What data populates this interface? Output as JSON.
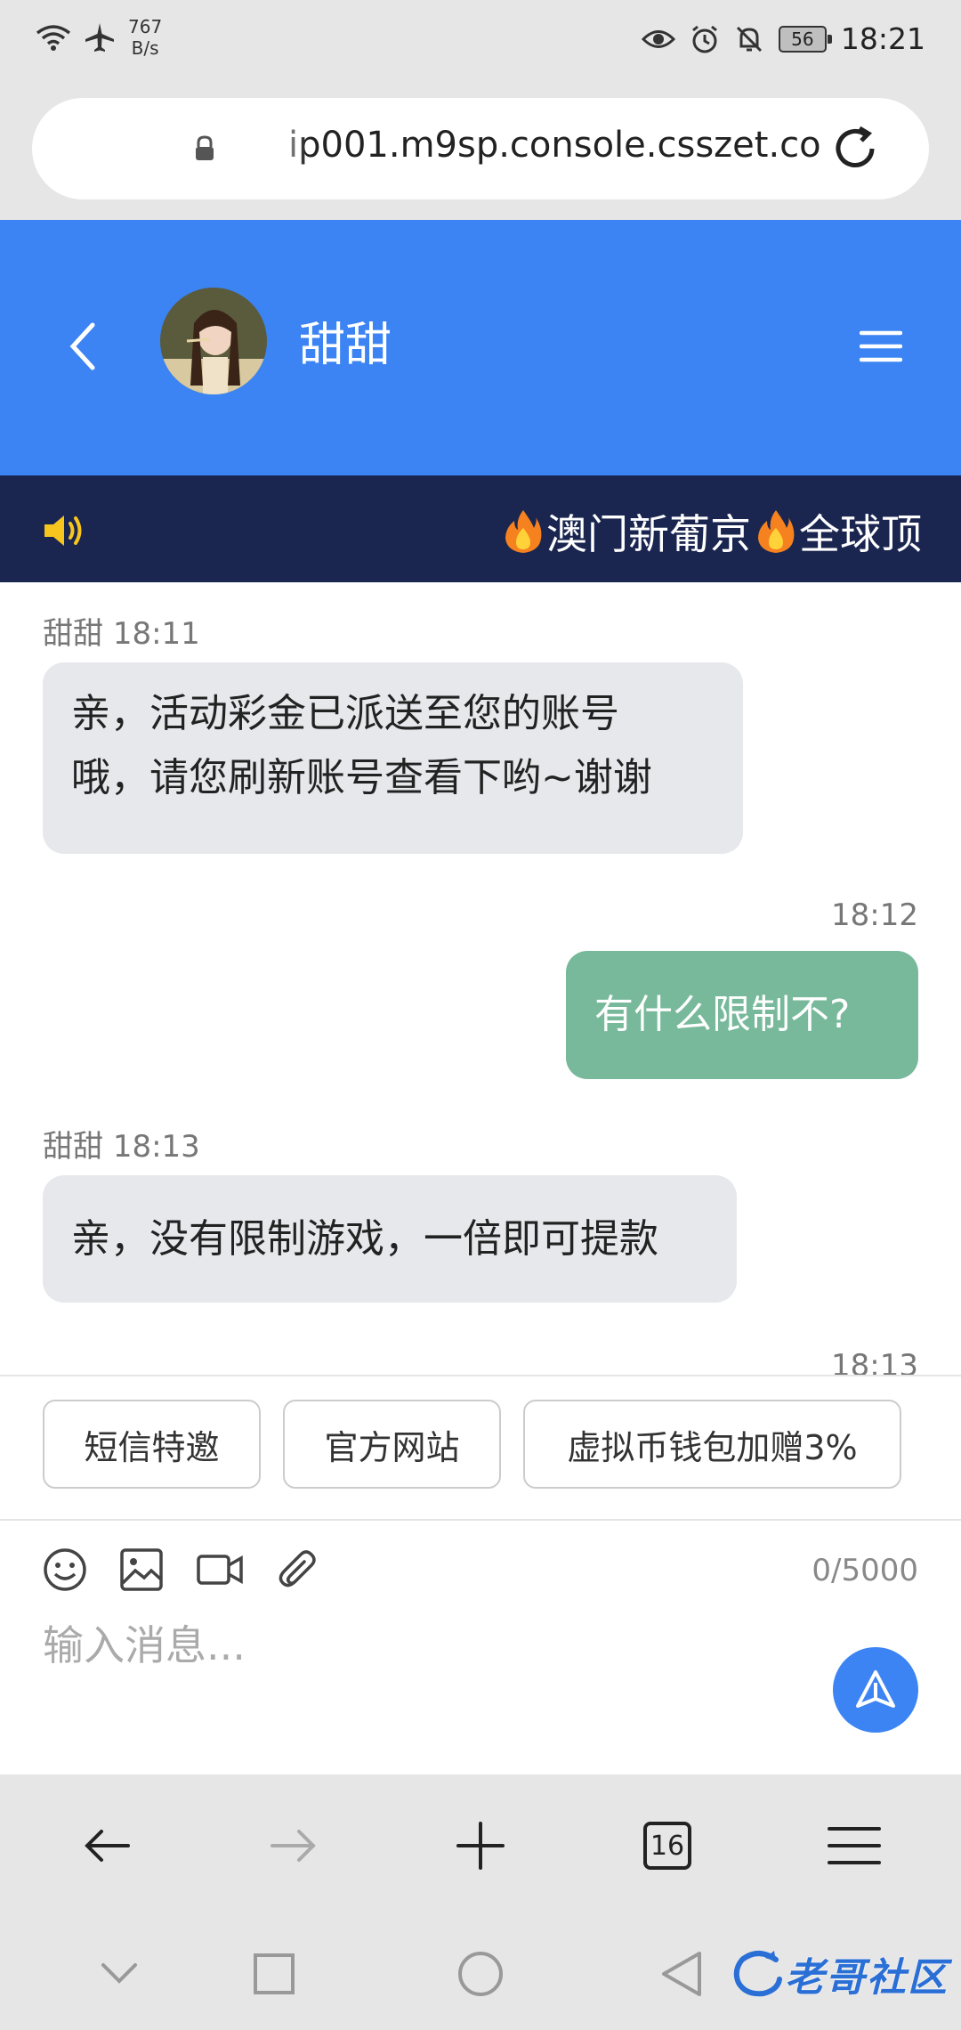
{
  "status_bar": {
    "net_speed_value": "767",
    "net_speed_unit": "B/s",
    "battery": "56",
    "time": "18:21"
  },
  "browser": {
    "url": "ip001.m9sp.console.csszet.co"
  },
  "header": {
    "name": "甜甜"
  },
  "marquee": {
    "text1": "澳门新葡京",
    "text2": "全球顶"
  },
  "messages": [
    {
      "sender": "甜甜",
      "time": "18:11",
      "line1": "亲，活动彩金已派送至您的账号",
      "line2": "哦，请您刷新账号查看下哟~谢谢"
    },
    {
      "time": "18:12",
      "text": "有什么限制不?"
    },
    {
      "sender": "甜甜",
      "time": "18:13",
      "text": "亲，没有限制游戏，一倍即可提款"
    },
    {
      "time": "18:13"
    }
  ],
  "quick_replies": [
    "短信特邀",
    "官方网站",
    "虚拟币钱包加赠3%"
  ],
  "composer": {
    "counter": "0/5000",
    "placeholder": "输入消息..."
  },
  "browser_bar": {
    "tab_count": "16"
  },
  "watermark": "老哥社区",
  "colors": {
    "header": "#3c84f3",
    "marquee": "#1a2650",
    "outgoing": "#77b99a",
    "incoming": "#e7e8ec"
  }
}
